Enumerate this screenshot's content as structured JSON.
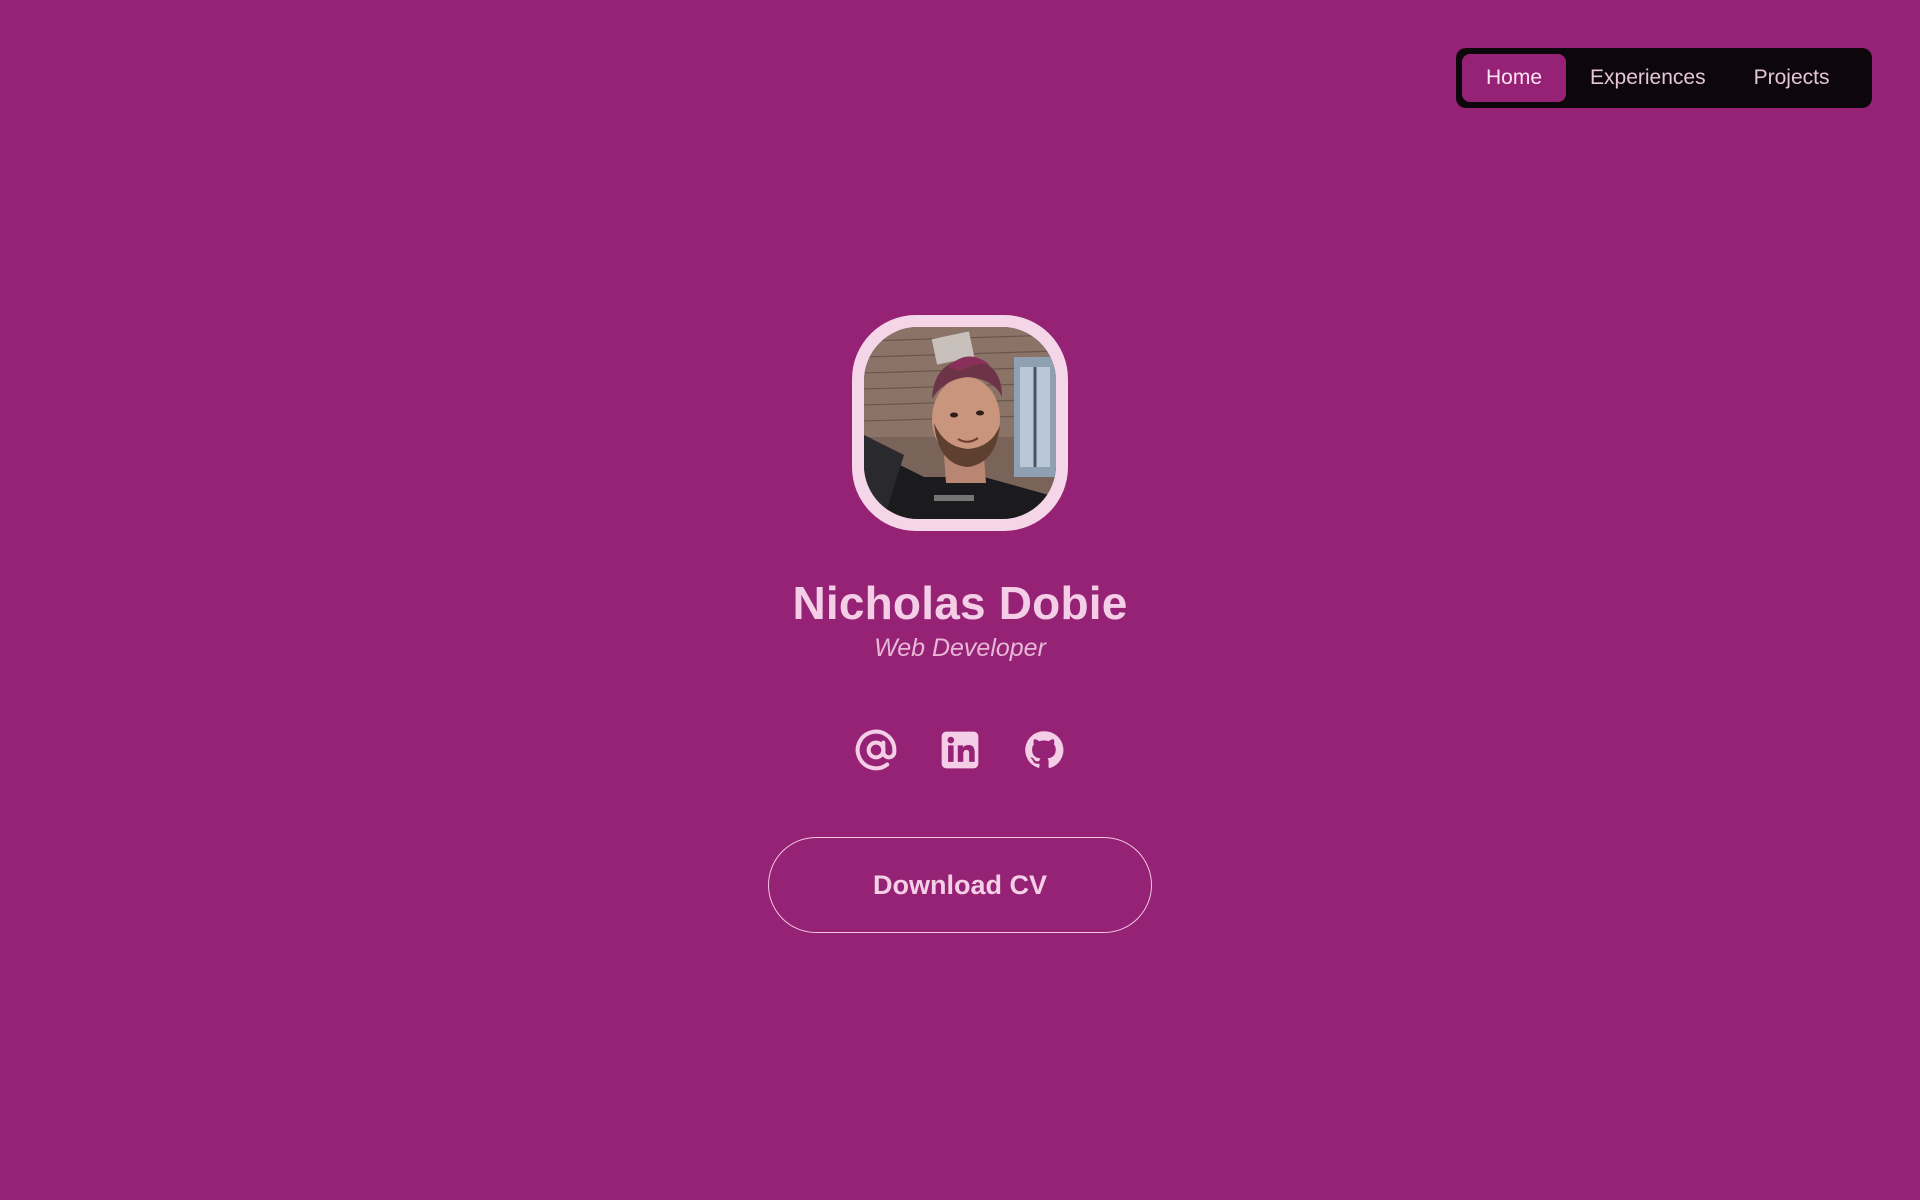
{
  "nav": {
    "items": [
      {
        "label": "Home",
        "active": true
      },
      {
        "label": "Experiences",
        "active": false
      },
      {
        "label": "Projects",
        "active": false
      }
    ]
  },
  "profile": {
    "name": "Nicholas Dobie",
    "role": "Web Developer",
    "avatar_icon": "profile-photo"
  },
  "socials": [
    {
      "icon": "at-sign-icon"
    },
    {
      "icon": "linkedin-icon"
    },
    {
      "icon": "github-icon"
    }
  ],
  "cta": {
    "label": "Download CV"
  },
  "colors": {
    "background": "#962275",
    "nav_background": "#0d060b",
    "accent_text": "#f4cde6"
  }
}
